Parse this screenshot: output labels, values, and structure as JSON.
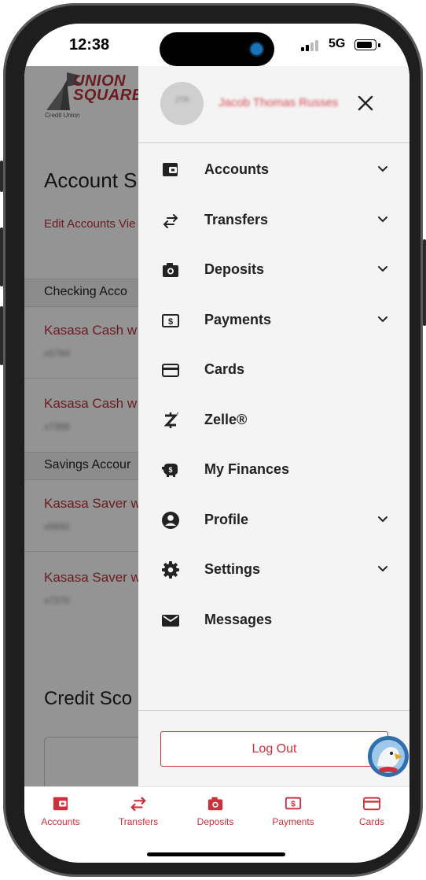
{
  "status_bar": {
    "time": "12:38",
    "network": "5G"
  },
  "background_page": {
    "logo": {
      "line1": "UNION",
      "line2": "SQUARE",
      "sub": "Credit Union"
    },
    "title": "Account Su",
    "link": "Edit Accounts Vie",
    "sections": [
      "Checking Acco",
      "Savings Accour"
    ],
    "accounts": [
      {
        "name": "Kasasa Cash w",
        "mask": "x5764"
      },
      {
        "name": "Kasasa Cash w",
        "mask": "x7368"
      },
      {
        "name": "Kasasa Saver w",
        "mask": "x5692"
      },
      {
        "name": "Kasasa Saver w",
        "mask": "x7370"
      }
    ],
    "credit_title": "Credit Sco"
  },
  "drawer": {
    "avatar_initials": "JTR",
    "user_name": "Jacob Thomas Russes",
    "menu": [
      {
        "label": "Accounts",
        "icon": "wallet-icon",
        "expandable": true
      },
      {
        "label": "Transfers",
        "icon": "transfer-arrows-icon",
        "expandable": true
      },
      {
        "label": "Deposits",
        "icon": "camera-icon",
        "expandable": true
      },
      {
        "label": "Payments",
        "icon": "dollar-bill-icon",
        "expandable": true
      },
      {
        "label": "Cards",
        "icon": "credit-card-icon",
        "expandable": false
      },
      {
        "label": "Zelle®",
        "icon": "zelle-icon",
        "expandable": false
      },
      {
        "label": "My Finances",
        "icon": "piggy-bank-icon",
        "expandable": false
      },
      {
        "label": "Profile",
        "icon": "user-circle-icon",
        "expandable": true
      },
      {
        "label": "Settings",
        "icon": "gear-icon",
        "expandable": true
      },
      {
        "label": "Messages",
        "icon": "envelope-icon",
        "expandable": false
      }
    ],
    "logout_label": "Log Out"
  },
  "tab_bar": [
    {
      "label": "Accounts",
      "icon": "wallet-icon"
    },
    {
      "label": "Transfers",
      "icon": "transfer-arrows-icon"
    },
    {
      "label": "Deposits",
      "icon": "camera-icon"
    },
    {
      "label": "Payments",
      "icon": "dollar-bill-icon"
    },
    {
      "label": "Cards",
      "icon": "credit-card-icon"
    }
  ],
  "colors": {
    "accent": "#c9323c",
    "drawer_bg": "#f4f4f4",
    "text": "#222222"
  }
}
